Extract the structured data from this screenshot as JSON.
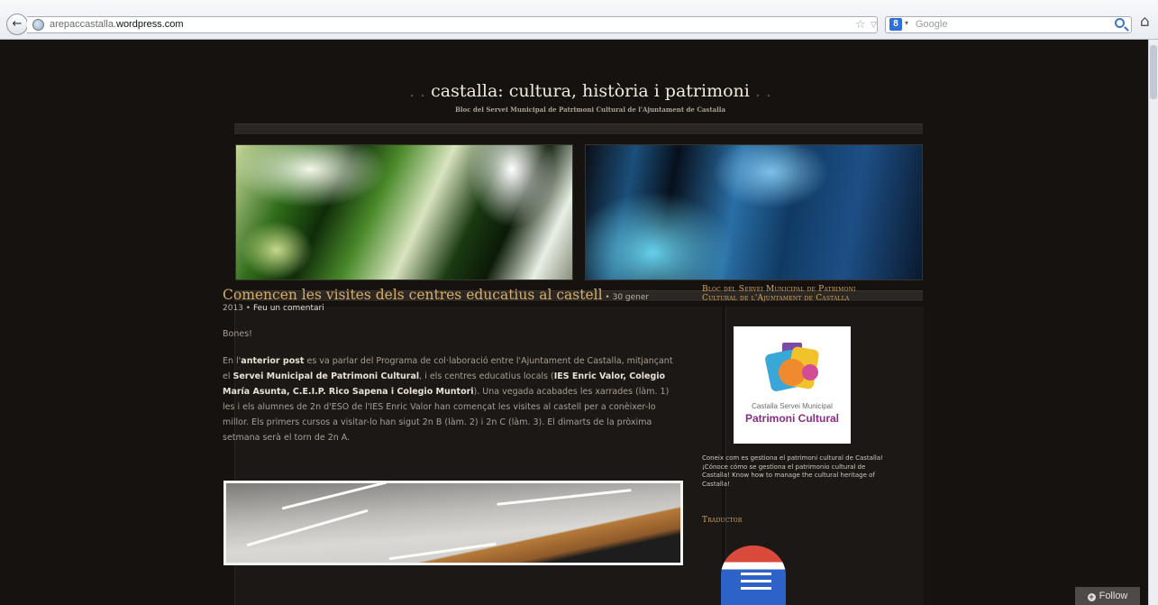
{
  "browser": {
    "url_prefix": "arepaccastalla.",
    "url_domain": "wordpress.com",
    "search_placeholder": "Google",
    "back_glyph": "←",
    "star_glyph": "☆",
    "dropdown_glyph": "▽",
    "reload_glyph": "C",
    "home_glyph": "⌂",
    "search_engine_glyph": "8",
    "engine_arrow_glyph": "▾"
  },
  "site": {
    "title": "castalla: cultura, història i patrimoni",
    "title_dots_left": ". .",
    "title_dots_right": ". .",
    "tagline": "Bloc del Servei Municipal de Patrimoni Cultural de l'Ajuntament de Castalla"
  },
  "post": {
    "title": "Comencen les visites dels centres educatius al castell",
    "date_sep": " • ",
    "date_part1": "30 gener",
    "date_part2": "2013",
    "meta_sep": " • ",
    "comments_link": "Feu un comentari",
    "greeting": "Bones!",
    "p1": [
      {
        "t": "En l'",
        "b": false
      },
      {
        "t": "anterior post",
        "b": true
      },
      {
        "t": " es va parlar del Programa de col·laboració entre l'Ajuntament de Castalla, mitjançant el ",
        "b": false
      },
      {
        "t": "Servei Municipal de Patrimoni Cultural",
        "b": true
      },
      {
        "t": ", i els centres educatius locals (",
        "b": false
      },
      {
        "t": "IES Enric Valor, Colegio María Asunta, C.E.I.P. Rico Sapena i Colegio Muntori",
        "b": true
      },
      {
        "t": "). Una vegada acabades les xarrades (làm. 1) les i els alumnes de 2n d'ESO de l'IES Enric Valor han començat les visites al castell per a conèixer-lo millor. Els primers cursos a visitar-lo han sigut 2n B (làm. 2) i 2n C (làm. 3). El dimarts de la pròxima setmana serà el torn de 2n A.",
        "b": false
      }
    ]
  },
  "sidebar": {
    "widget1_title": "Bloc del Servei Municipal de Patrimoni Cultural de l'Ajuntament de Castalla",
    "logo_line1": "Castalla Servei Municipal",
    "logo_line2": "Patrimoni Cultural",
    "widget1_text": "Coneix com es gestiona el patrimoni cultural de Castalla! ¡Cónoce cómo se gestiona el patrimonio cultural de Castalla! Know how to manage the cultural heritage of Castalla!",
    "widget2_title": "Traductor"
  },
  "follow": {
    "label": "Follow",
    "plus_glyph": "+"
  }
}
